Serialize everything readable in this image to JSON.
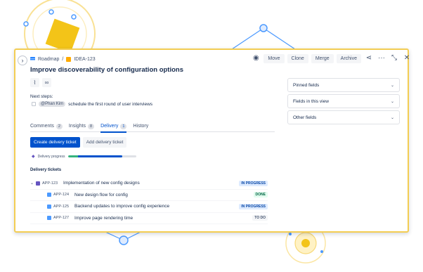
{
  "colors": {
    "accent": "#0052cc",
    "deco_yellow": "#f3cd53",
    "deco_blue": "#4c9aff"
  },
  "breadcrumb": {
    "project": "Roadmap",
    "separator": "/",
    "issue_key": "IDEA-123"
  },
  "toolbar": {
    "watch_icon": "eye-icon",
    "move_label": "Move",
    "clone_label": "Clone",
    "merge_label": "Merge",
    "archive_label": "Archive",
    "share_icon": "share-icon",
    "more_icon": "more-icon",
    "collapse_icon": "collapse-icon",
    "close_icon": "close-icon"
  },
  "issue": {
    "title": "Improve discoverability of configuration options",
    "attach_icon": "paperclip-icon",
    "link_icon": "link-icon",
    "next_steps_label": "Next steps:",
    "next_step": {
      "mention": "@Phan Kim",
      "text": "schedule the first round of user interviews"
    }
  },
  "tabs": [
    {
      "label": "Comments",
      "count": "2"
    },
    {
      "label": "Insights",
      "count": "8"
    },
    {
      "label": "Delivery",
      "count": "1",
      "active": true
    },
    {
      "label": "History",
      "count": ""
    }
  ],
  "actions": {
    "create_label": "Create delivery ticket",
    "add_label": "Add delivery ticket"
  },
  "progress": {
    "label": "Delivery progress",
    "done_fraction": 0.18,
    "in_progress_fraction": 0.82
  },
  "delivery": {
    "label": "Delivery tickets",
    "tickets": [
      {
        "key": "APP-123",
        "summary": "Implementation of new config designs",
        "status": "IN PROGRESS",
        "type": "epic",
        "parent": true
      },
      {
        "key": "APP-124",
        "summary": "New design flow for config",
        "status": "DONE",
        "type": "task",
        "parent": false
      },
      {
        "key": "APP-125",
        "summary": "Backend updates to improve config experience",
        "status": "IN PROGRESS",
        "type": "task",
        "parent": false
      },
      {
        "key": "APP-127",
        "summary": "Improve page rendering time",
        "status": "TO DO",
        "type": "task",
        "parent": false
      }
    ]
  },
  "side_fields": [
    {
      "label": "Pinned fields"
    },
    {
      "label": "Fields in this view"
    },
    {
      "label": "Other fields"
    }
  ]
}
